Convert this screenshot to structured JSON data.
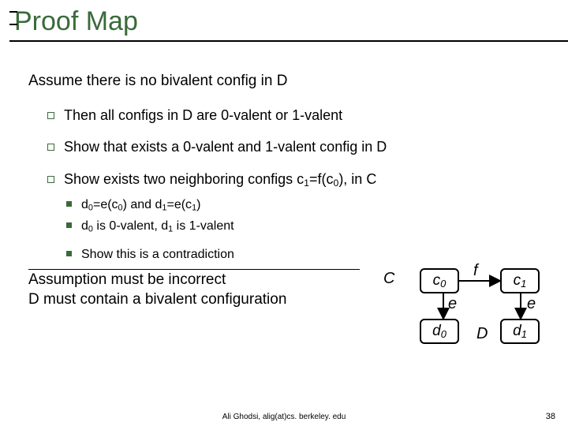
{
  "title": "Proof Map",
  "assume": "Assume there is no bivalent config in D",
  "b1": "Then all configs in D are 0-valent or 1-valent",
  "b2": "Show that exists a 0-valent and 1-valent config in D",
  "b3_pre": "Show exists two neighboring configs c",
  "b3_mid": "=f(c",
  "b3_post": "), in C",
  "s1a": "d",
  "s1b": "=e(c",
  "s1c": ") and d",
  "s1d": "=e(c",
  "s1e": ")",
  "s2a": "d",
  "s2b": " is 0-valent, d",
  "s2c": " is 1-valent",
  "s3": "Show this is a contradiction",
  "c1": "Assumption must be incorrect",
  "c2": "D must contain a bivalent configuration",
  "diagram": {
    "C": "C",
    "c0a": "c",
    "c0b": "0",
    "c1a": "c",
    "c1b": "1",
    "d0a": "d",
    "d0b": "0",
    "d1a": "d",
    "d1b": "1",
    "f": "f",
    "e": "e",
    "D": "D"
  },
  "footer": "Ali Ghodsi, alig(at)cs. berkeley. edu",
  "page": "38"
}
